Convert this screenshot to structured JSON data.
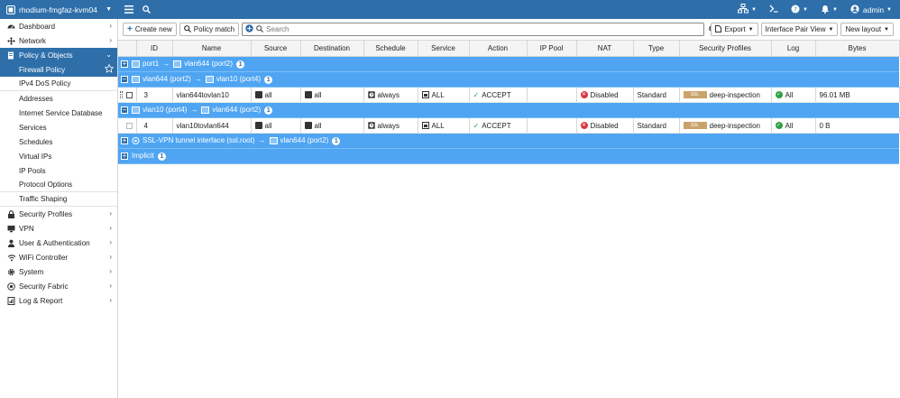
{
  "topbar": {
    "device_name": "rhodium-fmgfaz-kvm04",
    "user": "admin"
  },
  "sidebar": {
    "items": [
      {
        "label": "Dashboard"
      },
      {
        "label": "Network"
      },
      {
        "label": "Policy & Objects"
      }
    ],
    "sub_items": [
      {
        "label": "Firewall Policy"
      },
      {
        "label": "IPv4 DoS Policy"
      },
      {
        "label": "Addresses"
      },
      {
        "label": "Internet Service Database"
      },
      {
        "label": "Services"
      },
      {
        "label": "Schedules"
      },
      {
        "label": "Virtual IPs"
      },
      {
        "label": "IP Pools"
      },
      {
        "label": "Protocol Options"
      },
      {
        "label": "Traffic Shaping"
      }
    ],
    "bottom_items": [
      {
        "label": "Security Profiles"
      },
      {
        "label": "VPN"
      },
      {
        "label": "User & Authentication"
      },
      {
        "label": "WiFi Controller"
      },
      {
        "label": "System"
      },
      {
        "label": "Security Fabric"
      },
      {
        "label": "Log & Report"
      }
    ]
  },
  "toolbar": {
    "create_new": "Create new",
    "policy_match": "Policy match",
    "search_placeholder": "Search",
    "export": "Export",
    "interface_pair_view": "Interface Pair View",
    "new_layout": "New layout"
  },
  "table": {
    "columns": [
      "ID",
      "Name",
      "Source",
      "Destination",
      "Schedule",
      "Service",
      "Action",
      "IP Pool",
      "NAT",
      "Type",
      "Security Profiles",
      "Log",
      "Bytes"
    ],
    "sections": [
      {
        "from": "port1",
        "to": "vlan644 (port2)",
        "count": "1"
      },
      {
        "from": "vlan644 (port2)",
        "to": "vlan10 (port4)",
        "count": "1"
      },
      {
        "from": "vlan10 (port4)",
        "to": "vlan644 (port2)",
        "count": "1"
      },
      {
        "from": "SSL-VPN tunnel interface (ssl.root)",
        "to": "vlan644 (port2)",
        "count": "1"
      },
      {
        "from": "Implicit",
        "count": "1"
      }
    ],
    "rows": [
      {
        "id": "3",
        "name": "vlan644tovlan10",
        "source": "all",
        "destination": "all",
        "schedule": "always",
        "service": "ALL",
        "action": "ACCEPT",
        "ip_pool": "",
        "nat": "Disabled",
        "type": "Standard",
        "ssl_tag": "SSL",
        "security_profile": "deep-inspection",
        "log": "All",
        "bytes": "96.01 MB"
      },
      {
        "id": "4",
        "name": "vlan10tovlan644",
        "source": "all",
        "destination": "all",
        "schedule": "always",
        "service": "ALL",
        "action": "ACCEPT",
        "ip_pool": "",
        "nat": "Disabled",
        "type": "Standard",
        "ssl_tag": "SSL",
        "security_profile": "deep-inspection",
        "log": "All",
        "bytes": "0 B"
      }
    ]
  },
  "colors": {
    "topbar": "#2e6faa",
    "section_row": "#4fa5f2",
    "accept": "#2ea043",
    "disabled": "#d9363e"
  }
}
